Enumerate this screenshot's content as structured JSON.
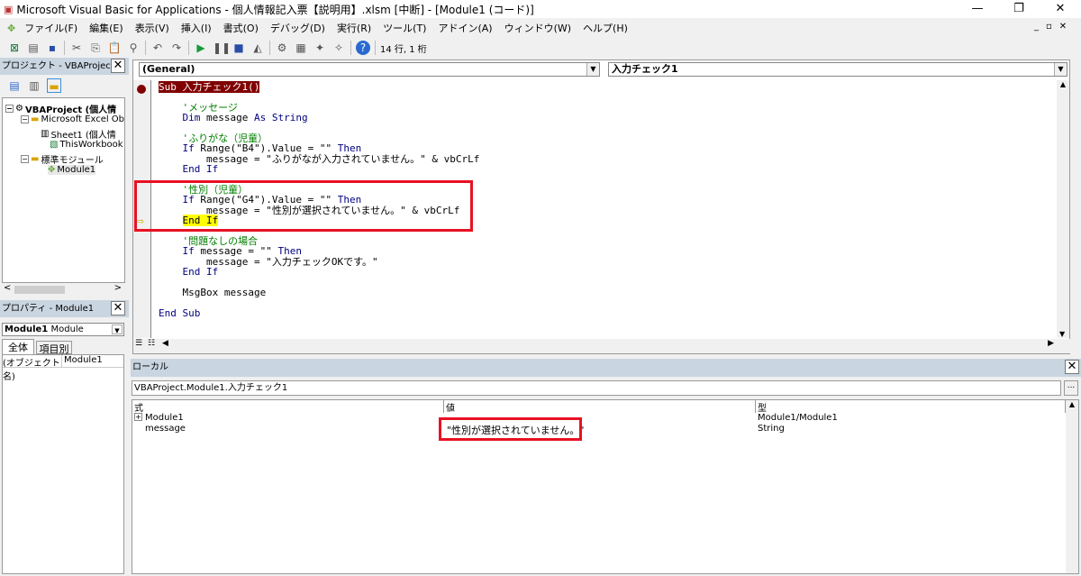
{
  "window": {
    "title": "Microsoft Visual Basic for Applications - 個人情報記入票【説明用】.xlsm [中断] - [Module1 (コード)]",
    "minimize": "—",
    "restore": "❐",
    "close": "✕"
  },
  "menu": [
    "ファイル(F)",
    "編集(E)",
    "表示(V)",
    "挿入(I)",
    "書式(O)",
    "デバッグ(D)",
    "実行(R)",
    "ツール(T)",
    "アドイン(A)",
    "ウィンドウ(W)",
    "ヘルプ(H)"
  ],
  "toolbar": {
    "position": "14 行, 1 桁"
  },
  "project": {
    "title": "プロジェクト - VBAProject",
    "tree": [
      "VBAProject (個人情",
      "Microsoft Excel Ob",
      "Sheet1 (個人情",
      "ThisWorkbook",
      "標準モジュール",
      "Module1"
    ]
  },
  "properties": {
    "title": "プロパティ - Module1",
    "object": "Module1",
    "object_type": "Module",
    "tabs": [
      "全体",
      "項目別"
    ],
    "row_name": "(オブジェクト名)",
    "row_value": "Module1"
  },
  "code": {
    "object_combo": "(General)",
    "proc_combo": "入力チェック1",
    "lines": [
      [
        {
          "t": "Sub 入力チェック1()",
          "c": "bp"
        }
      ],
      [],
      [
        {
          "t": "    'メッセージ",
          "c": "cm"
        }
      ],
      [
        {
          "t": "    Dim",
          "c": "kw"
        },
        {
          "t": " message ",
          "c": "tx"
        },
        {
          "t": "As String",
          "c": "kw"
        }
      ],
      [],
      [
        {
          "t": "    'ふりがな（児童）",
          "c": "cm"
        }
      ],
      [
        {
          "t": "    If",
          "c": "kw"
        },
        {
          "t": " Range(\"B4\").Value = \"\" ",
          "c": "tx"
        },
        {
          "t": "Then",
          "c": "kw"
        }
      ],
      [
        {
          "t": "        message = \"ふりがなが入力されていません。\" & vbCrLf",
          "c": "tx"
        }
      ],
      [
        {
          "t": "    End If",
          "c": "kw"
        }
      ],
      [],
      [
        {
          "t": "    '性別（児童）",
          "c": "cm"
        }
      ],
      [
        {
          "t": "    If",
          "c": "kw"
        },
        {
          "t": " Range(\"G4\").Value = \"\" ",
          "c": "tx"
        },
        {
          "t": "Then",
          "c": "kw"
        }
      ],
      [
        {
          "t": "        message = \"性別が選択されていません。\" & vbCrLf",
          "c": "tx"
        }
      ],
      [
        {
          "t": "    ",
          "c": "tx"
        },
        {
          "t": "End If",
          "c": "exec"
        }
      ],
      [],
      [
        {
          "t": "    '問題なしの場合",
          "c": "cm"
        }
      ],
      [
        {
          "t": "    If",
          "c": "kw"
        },
        {
          "t": " message = \"\" ",
          "c": "tx"
        },
        {
          "t": "Then",
          "c": "kw"
        }
      ],
      [
        {
          "t": "        message = \"入力チェックOKです。\"",
          "c": "tx"
        }
      ],
      [
        {
          "t": "    End If",
          "c": "kw"
        }
      ],
      [],
      [
        {
          "t": "    MsgBox message",
          "c": "tx"
        }
      ],
      [],
      [
        {
          "t": "End Sub",
          "c": "kw"
        }
      ]
    ]
  },
  "locals": {
    "title": "ローカル",
    "context": "VBAProject.Module1.入力チェック1",
    "context_btn": "...",
    "headers": [
      "式",
      "値",
      "型"
    ],
    "rows": [
      {
        "expr": "Module1",
        "value": "",
        "type": "Module1/Module1",
        "expand": "+"
      },
      {
        "expr": "message",
        "value": "\"性別が選択されていません。\"",
        "type": "String"
      }
    ]
  },
  "colors": {
    "highlight_box": "#e81123",
    "exec_line": "#ffff00",
    "breakpoint": "#800000",
    "keyword": "#00007f",
    "comment": "#007f00"
  }
}
